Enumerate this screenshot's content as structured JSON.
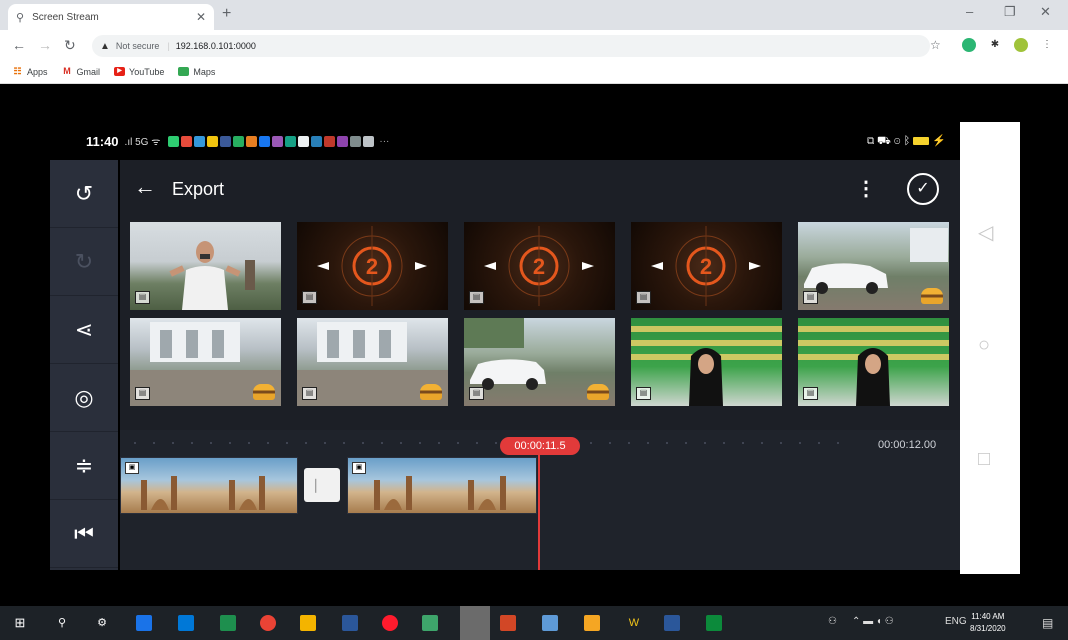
{
  "browser": {
    "tab_title": "Screen Stream",
    "security_label": "Not secure",
    "url": "192.168.0.101:0000",
    "bookmarks": [
      {
        "label": "Apps",
        "icon": "apps-grid-icon"
      },
      {
        "label": "Gmail",
        "icon": "gmail-icon"
      },
      {
        "label": "YouTube",
        "icon": "youtube-icon"
      },
      {
        "label": "Maps",
        "icon": "maps-icon"
      }
    ]
  },
  "phone": {
    "status_time": "11:40"
  },
  "app": {
    "title": "Export",
    "playhead_time": "00:00:11.5",
    "end_time": "00:00:12.00",
    "thumbnails": [
      {
        "kind": "person"
      },
      {
        "kind": "countdown",
        "digit": "2"
      },
      {
        "kind": "countdown",
        "digit": "2"
      },
      {
        "kind": "countdown",
        "digit": "2"
      },
      {
        "kind": "car"
      },
      {
        "kind": "house"
      },
      {
        "kind": "house"
      },
      {
        "kind": "car"
      },
      {
        "kind": "banner"
      },
      {
        "kind": "banner"
      }
    ]
  },
  "taskbar": {
    "clock_time": "11:40 AM",
    "clock_date": "8/31/2020",
    "lang": "ENG"
  },
  "colors": {
    "accent_red": "#e23a3a",
    "panel_dark": "#1c1f26",
    "sidebar": "#2a2f3b"
  }
}
